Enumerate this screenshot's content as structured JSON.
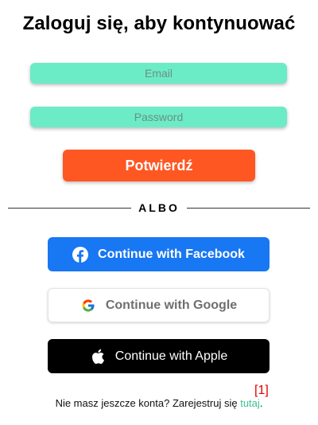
{
  "header": {
    "title": "Zaloguj się, aby kontynuować"
  },
  "form": {
    "email_placeholder": "Email",
    "email_value": "",
    "password_placeholder": "Password",
    "password_value": "",
    "submit_label": "Potwierdź"
  },
  "divider": {
    "label": "ALBO"
  },
  "social": {
    "facebook_label": "Continue with Facebook",
    "facebook_icon": "facebook-icon",
    "google_label": "Continue with Google",
    "google_icon": "google-icon",
    "apple_label": "Continue with Apple",
    "apple_icon": "apple-icon"
  },
  "footer": {
    "marker": "[1]",
    "prompt": "Nie masz jeszcze konta? Zarejestruj się ",
    "link_label": "tutaj",
    "end": "."
  },
  "colors": {
    "field_bg": "#6cecc6",
    "submit_bg": "#ff5722",
    "facebook_bg": "#1877f2",
    "apple_bg": "#000000",
    "link": "#3fbf95",
    "marker": "#e00000"
  }
}
